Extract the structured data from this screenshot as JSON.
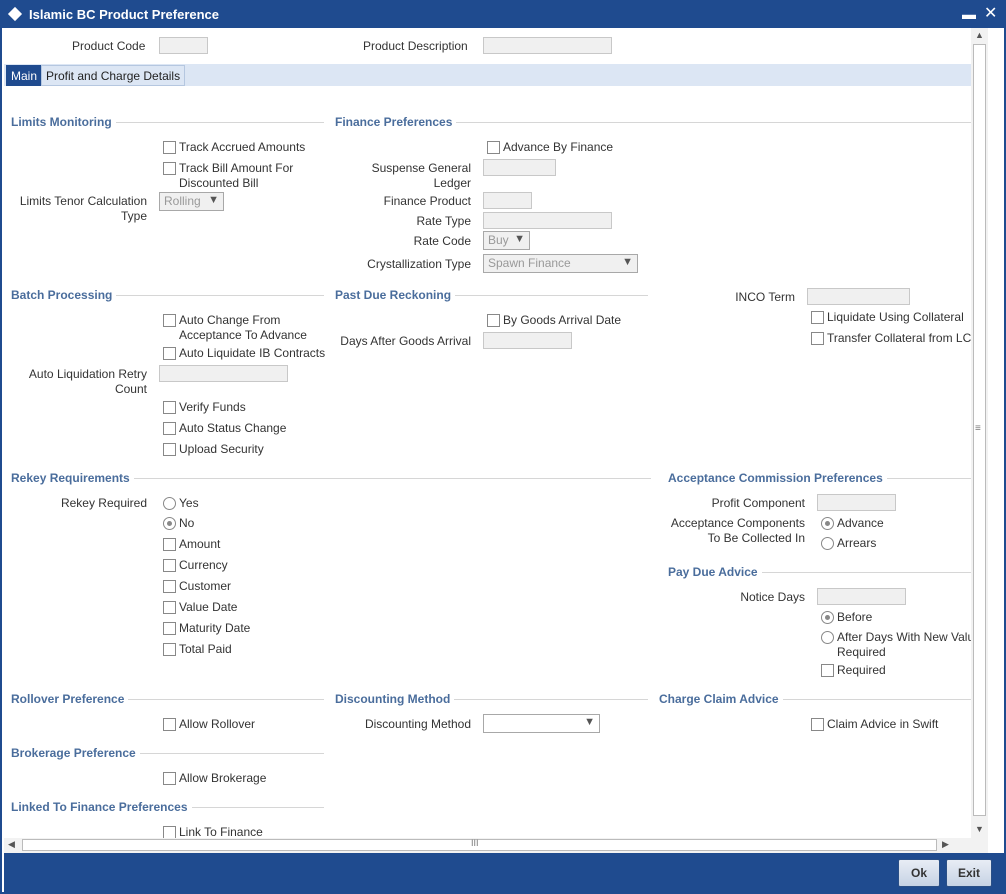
{
  "window": {
    "title": "Islamic BC Product Preference",
    "minimize_icon": "minimize-icon",
    "close_icon": "close-icon"
  },
  "header": {
    "product_code_label": "Product Code",
    "product_code_value": "",
    "product_description_label": "Product Description",
    "product_description_value": ""
  },
  "tabs": [
    {
      "label": "Main",
      "active": true
    },
    {
      "label": "Profit and Charge Details",
      "active": false
    }
  ],
  "limits_monitoring": {
    "title": "Limits Monitoring",
    "track_accrued": "Track Accrued Amounts",
    "track_bill_1": "Track Bill Amount For",
    "track_bill_2": "Discounted Bill",
    "tenor_label_1": "Limits Tenor Calculation",
    "tenor_label_2": "Type",
    "tenor_value": "Rolling"
  },
  "finance_preferences": {
    "title": "Finance Preferences",
    "advance_by_finance": "Advance By Finance",
    "suspense_label_1": "Suspense General",
    "suspense_label_2": "Ledger",
    "finance_product_label": "Finance Product",
    "rate_type_label": "Rate Type",
    "rate_code_label": "Rate Code",
    "rate_code_value": "Buy",
    "crystallization_label": "Crystallization Type",
    "crystallization_value": "Spawn Finance"
  },
  "batch_processing": {
    "title": "Batch Processing",
    "auto_change_1": "Auto Change From",
    "auto_change_2": "Acceptance To Advance",
    "auto_liquidate_ib": "Auto Liquidate IB Contracts",
    "retry_label_1": "Auto Liquidation Retry",
    "retry_label_2": "Count",
    "verify_funds": "Verify Funds",
    "auto_status_change": "Auto Status Change",
    "upload_security": "Upload Security"
  },
  "past_due": {
    "title": "Past Due Reckoning",
    "by_goods_arrival": "By Goods Arrival Date",
    "days_after_label": "Days After Goods Arrival"
  },
  "inco": {
    "inco_term_label": "INCO Term",
    "liquidate_collateral": "Liquidate Using Collateral",
    "transfer_collateral": "Transfer Collateral from LC"
  },
  "rekey": {
    "title": "Rekey Requirements",
    "required_label": "Rekey Required",
    "yes": "Yes",
    "no": "No",
    "amount": "Amount",
    "currency": "Currency",
    "customer": "Customer",
    "value_date": "Value Date",
    "maturity_date": "Maturity Date",
    "total_paid": "Total Paid"
  },
  "acceptance_commission": {
    "title": "Acceptance Commission Preferences",
    "profit_component_label": "Profit Component",
    "components_label_1": "Acceptance Components",
    "components_label_2": "To Be Collected In",
    "advance": "Advance",
    "arrears": "Arrears"
  },
  "pay_due_advice": {
    "title": "Pay Due Advice",
    "notice_days_label": "Notice Days",
    "before": "Before",
    "after_1": "After Days With New Value",
    "after_2": "Required",
    "required": "Required"
  },
  "rollover": {
    "title": "Rollover Preference",
    "allow_rollover": "Allow Rollover"
  },
  "discounting": {
    "title": "Discounting Method",
    "label": "Discounting Method",
    "value": ""
  },
  "charge_claim": {
    "title": "Charge Claim Advice",
    "claim_swift": "Claim Advice in Swift"
  },
  "brokerage": {
    "title": "Brokerage Preference",
    "allow_brokerage": "Allow Brokerage"
  },
  "linked_finance": {
    "title": "Linked To Finance Preferences",
    "link_to_finance": "Link To Finance"
  },
  "scroll": {
    "up": "▲",
    "down": "▼",
    "left": "◀",
    "right": "▶",
    "grip": "≡",
    "hgrip": "III"
  },
  "footer": {
    "ok": "Ok",
    "exit": "Exit"
  },
  "colors": {
    "title_bar": "#1f4b8f",
    "section_heading": "#4a6d9c",
    "tab_strip": "#dce6f4"
  }
}
